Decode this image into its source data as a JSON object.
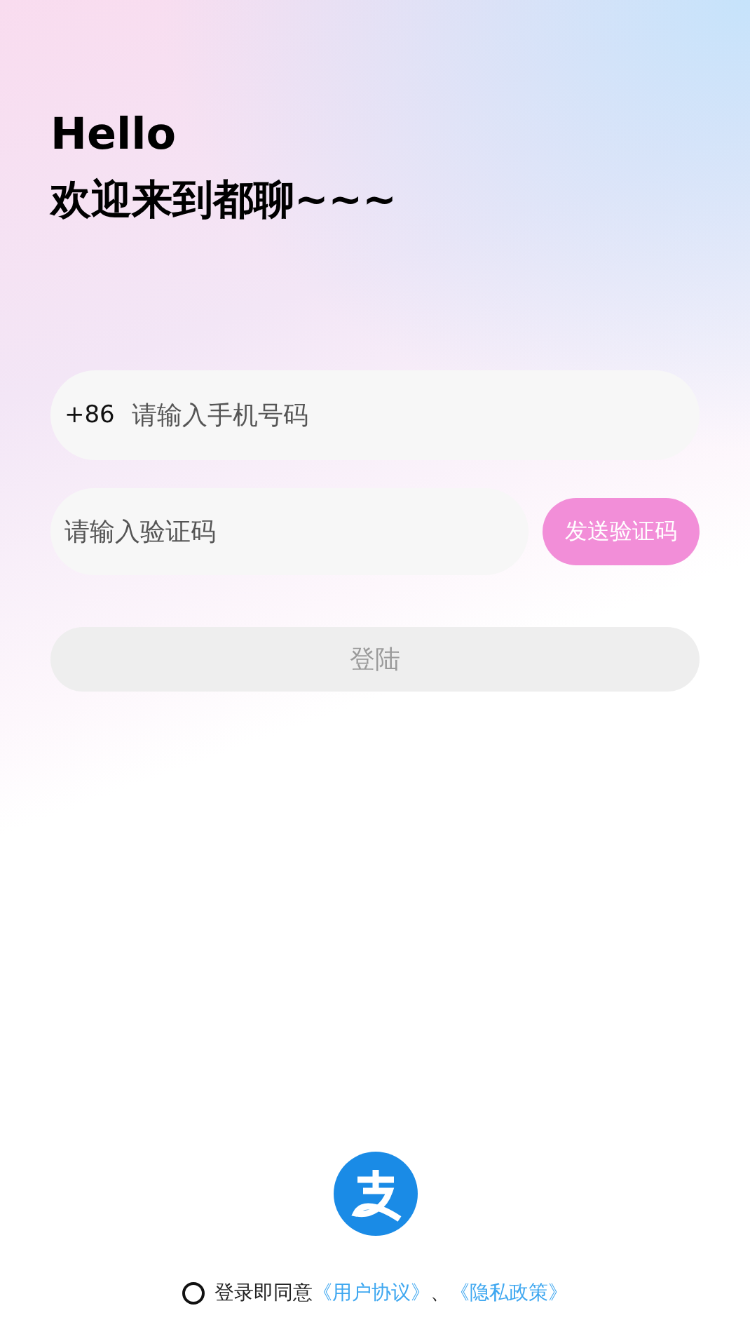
{
  "greeting": {
    "title": "Hello",
    "subtitle": "欢迎来到都聊~~~"
  },
  "phone_field": {
    "prefix": "+86",
    "placeholder": "请输入手机号码"
  },
  "code_field": {
    "placeholder": "请输入验证码"
  },
  "send_code_button": {
    "label": "发送验证码",
    "disabled": false
  },
  "login_button": {
    "label": "登陆",
    "disabled": true
  },
  "agreement": {
    "checked": false,
    "text": "登录即同意",
    "links": [
      "《用户协议》",
      "《隐私政策》"
    ],
    "separator": "、"
  }
}
